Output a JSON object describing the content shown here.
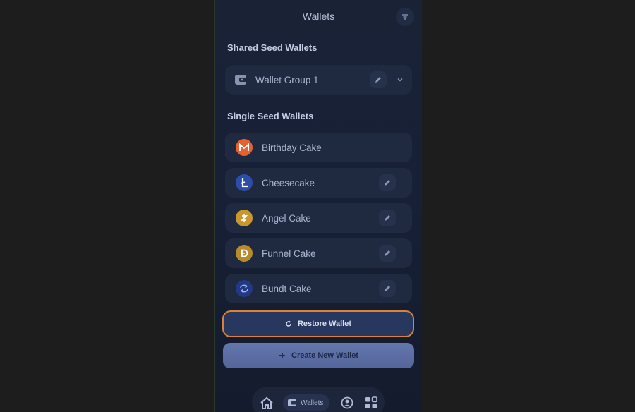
{
  "header": {
    "title": "Wallets"
  },
  "sections": {
    "shared": {
      "title": "Shared Seed Wallets"
    },
    "single": {
      "title": "Single Seed Wallets"
    }
  },
  "wallet_group": {
    "label": "Wallet Group 1"
  },
  "wallets": [
    {
      "label": "Birthday Cake",
      "icon": "monero-icon",
      "selected": true
    },
    {
      "label": "Cheesecake",
      "icon": "litecoin-icon"
    },
    {
      "label": "Angel Cake",
      "icon": "zcash-icon"
    },
    {
      "label": "Funnel Cake",
      "icon": "dogecoin-icon"
    },
    {
      "label": "Bundt Cake",
      "icon": "swap-coin-icon"
    }
  ],
  "buttons": {
    "restore": "Restore Wallet",
    "create": "Create New Wallet"
  },
  "nav": {
    "wallets_label": "Wallets"
  },
  "colors": {
    "accent_orange": "#d9833a",
    "selected_bar": "#7d8fd8"
  }
}
